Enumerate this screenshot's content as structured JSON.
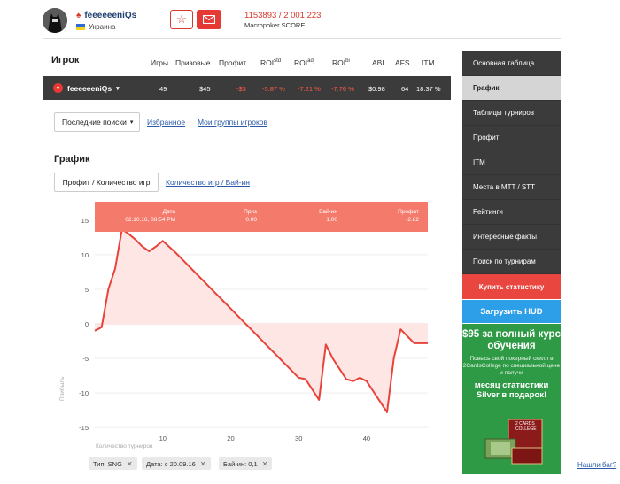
{
  "header": {
    "username": "feeeeeeniQs",
    "country": "Украина",
    "score": "1153893 / 2 001 223",
    "score_label": "Macropoker SCORE"
  },
  "table": {
    "headers": {
      "player": "Игрок",
      "games": "Игры",
      "prize": "Призовые",
      "profit": "Профит",
      "roi_std": "ROI",
      "roi_std_sup": "std",
      "roi_adj": "ROI",
      "roi_adj_sup": "adj",
      "roi_bi": "ROI",
      "roi_bi_sup": "bi",
      "abi": "ABI",
      "afs": "AFS",
      "itm": "ITM"
    },
    "row": {
      "player": "feeeeeeniQs",
      "games": "49",
      "prize": "$45",
      "profit": "-$3",
      "roi_std": "-5.87 %",
      "roi_adj": "-7.21 %",
      "roi_bi": "-7.76 %",
      "abi": "$0.98",
      "afs": "64",
      "itm": "18.37 %"
    }
  },
  "filters": {
    "select_label": "Последние поиски",
    "favorites": "Избранное",
    "my_groups": "Мои группы игроков"
  },
  "graph": {
    "title": "График",
    "tab_active": "Профит / Количество игр",
    "tab_other": "Количество игр / Бай-ин"
  },
  "tooltip": {
    "date_label": "Дата",
    "date_value": "02.10.16, 08:54 PM",
    "prize_label": "Приз",
    "prize_value": "0.00",
    "buyin_label": "Бай-ин",
    "buyin_value": "1.00",
    "profit_label": "Профит",
    "profit_value": "-2.82"
  },
  "chart_data": {
    "type": "area",
    "xlabel": "Количество турниров",
    "ylabel": "Прибыль",
    "xlim": [
      0,
      49
    ],
    "ylim": [
      -15.5,
      15.5
    ],
    "xticks": [
      10,
      20,
      30,
      40
    ],
    "yticks": [
      15,
      10,
      5,
      0,
      -5,
      -10,
      -15
    ],
    "x": [
      0,
      1,
      2,
      3,
      4,
      5,
      6,
      7,
      8,
      9,
      10,
      11,
      12,
      13,
      14,
      15,
      16,
      17,
      18,
      19,
      20,
      21,
      22,
      23,
      24,
      25,
      26,
      27,
      28,
      29,
      30,
      31,
      32,
      33,
      34,
      35,
      36,
      37,
      38,
      39,
      40,
      41,
      42,
      43,
      44,
      45,
      46,
      47,
      48,
      49
    ],
    "y": [
      -1,
      -0.5,
      5,
      8,
      13.7,
      13,
      12.2,
      11.2,
      10.5,
      11.2,
      12,
      11.1,
      10.2,
      9.2,
      8.2,
      7.2,
      6.2,
      5.2,
      4.2,
      3.2,
      2.2,
      1.2,
      0.2,
      -0.8,
      -1.8,
      -2.8,
      -3.8,
      -4.8,
      -5.8,
      -6.8,
      -7.8,
      -8,
      -9.5,
      -11,
      -3,
      -5,
      -6.5,
      -8,
      -8.3,
      -7.8,
      -8.3,
      -9.8,
      -11.3,
      -12.8,
      -5,
      -0.8,
      -1.8,
      -2.8,
      -2.8,
      -2.8
    ],
    "line_color": "#e8423a",
    "fill_color": "#fde6e4",
    "tooltip_color": "#f47a6c"
  },
  "tags": [
    "Тип: SNG",
    "Дата: с 20.09.16",
    "Бай-ин: 0,1"
  ],
  "sidebar": {
    "items": [
      "Основная таблица",
      "График",
      "Таблицы турниров",
      "Профит",
      "ITM",
      "Места в MTT / STT",
      "Рейтинги",
      "Интересные факты",
      "Поиск по турнирам"
    ],
    "buy_stats": "Купить статистику",
    "load_hud": "Загрузить HUD"
  },
  "ad": {
    "headline": "$95 за полный курс обучения",
    "sub": "Повысь свой покерный скилл в 2CardsCollege по специальной цене и получи",
    "main": "месяц статистики Silver в подарок!",
    "brand": "2 CARDS COLLEGE"
  },
  "footer": {
    "report_bug": "Нашли баг?"
  }
}
